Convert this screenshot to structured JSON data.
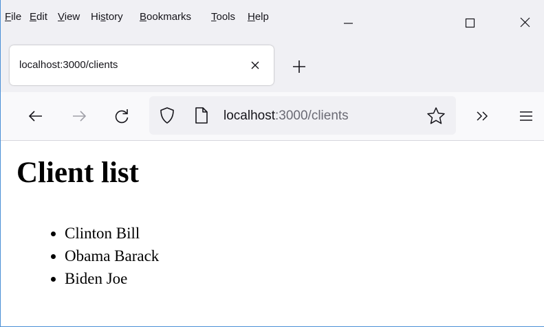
{
  "menu": {
    "items": [
      {
        "label": "File"
      },
      {
        "label": "Edit"
      },
      {
        "label": "View"
      },
      {
        "label": "History"
      },
      {
        "label": "Bookmarks"
      },
      {
        "label": "Tools"
      },
      {
        "label": "Help"
      }
    ]
  },
  "tab": {
    "title": "localhost:3000/clients"
  },
  "urlbar": {
    "host": "localhost",
    "rest": ":3000/clients"
  },
  "page": {
    "title": "Client list",
    "clients": [
      "Clinton Bill",
      "Obama Barack",
      "Biden Joe"
    ]
  },
  "colors": {
    "chrome_bg": "#f0f0f4",
    "toolbar_bg": "#f9f9fb",
    "window_border": "#4a8fd6"
  }
}
